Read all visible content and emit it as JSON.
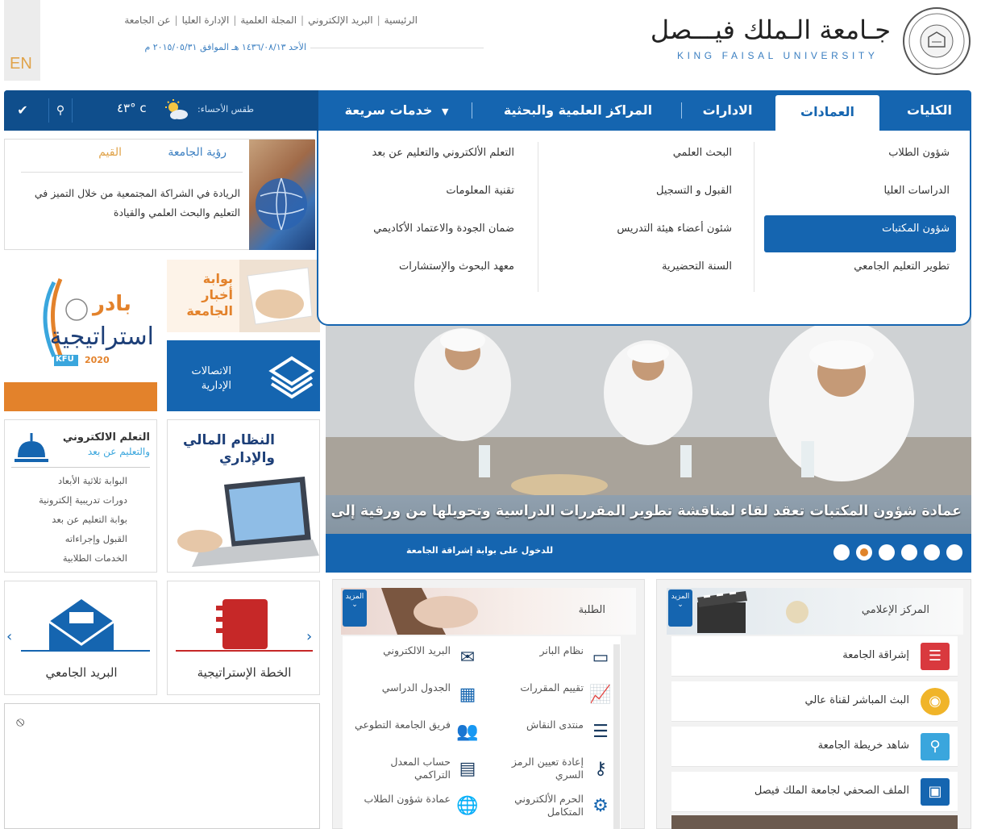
{
  "header": {
    "en_label": "EN",
    "top_links": [
      "الرئيسية",
      "البريد الإلكتروني",
      "المجلة العلمية",
      "الإدارة العليا",
      "عن الجامعة"
    ],
    "date_line": "الأحد ١٤٣٦/٠٨/١٣ هـ الموافق ٢٠١٥/٠٥/٣١ م",
    "logo_ar": "جـامعة الـملك فيـــصل",
    "logo_en": "KING FAISAL UNIVERSITY"
  },
  "nav": {
    "items": [
      "الكليات",
      "العمادات",
      "الادارات",
      "المراكز العلمية والبحثية",
      "خدمات سريعة"
    ],
    "active": "العمادات",
    "weather_label": "طقس الأحساء:",
    "weather_temp": "٤٣° c",
    "weather_icon": "sun-cloud-icon",
    "search_icon": "search-icon",
    "check_icon": "check-icon"
  },
  "dropdown": {
    "col1": [
      "شؤون الطلاب",
      "الدراسات العليا",
      "شؤون المكتبات",
      "تطوير التعليم الجامعي"
    ],
    "col2": [
      "البحث العلمي",
      "القبول و التسجيل",
      "شئون أعضاء هيئة التدريس",
      "السنة التحضيرية"
    ],
    "col3": [
      "التعلم الألكتروني والتعليم عن بعد",
      "تقنية المعلومات",
      "ضمان الجودة والاعتماد الأكاديمي",
      "معهد البحوث والإستشارات"
    ],
    "highlighted": "شؤون المكتبات"
  },
  "vision": {
    "tab_vision": "رؤية الجامعة",
    "tab_values": "القيم",
    "text": "الريادة في الشراكة المجتمعية من خلال التميز في التعليم والبحث العلمي والقيادة"
  },
  "tiles": {
    "strategy_top": "بادر",
    "strategy_main": "استراتيجية",
    "strategy_kfu": "KFU",
    "strategy_year": "2020",
    "news": "بوابة أخبار الجامعة",
    "comm": "الاتصالات الإدارية",
    "elearn_title": "التعلم الالكتروني",
    "elearn_sub": "والتعليم عن بعد",
    "elearn_links": [
      "البوابة ثلاثية الأبعاد",
      "دورات تدريبية إلكترونية",
      "بوابة التعليم عن بعد",
      "القبول وإجراءاته",
      "الخدمات الطلابية"
    ],
    "fin": "النظام المالي والإداري",
    "mail": "البريد الجامعي",
    "plan": "الخطة الإستراتيجية"
  },
  "hero": {
    "caption": "عمادة شؤون المكتبات تعقد لقاء لمناقشة تطوير المقررات الدراسية وتحويلها من ورقية إلى",
    "link": "للدخول على بوابة إشراقة الجامعة",
    "dots": 6,
    "active_dot": 5
  },
  "students": {
    "title": "الطلبة",
    "more": "المزيد",
    "items": [
      {
        "label": "نظام البانر",
        "icon": "monitor-icon"
      },
      {
        "label": "البريد الالكتروني",
        "icon": "mail-icon"
      },
      {
        "label": "تقييم المقررات",
        "icon": "chart-icon"
      },
      {
        "label": "الجدول الدراسي",
        "icon": "calendar-icon"
      },
      {
        "label": "منتدى النقاش",
        "icon": "forum-icon"
      },
      {
        "label": "فريق الجامعة التطوعي",
        "icon": "team-icon"
      },
      {
        "label": "إعادة تعيين الرمز السري",
        "icon": "key-icon"
      },
      {
        "label": "حساب المعدل التراكمي",
        "icon": "calculator-icon"
      },
      {
        "label": "الحرم الألكتروني المتكامل",
        "icon": "network-icon"
      },
      {
        "label": "عمادة شؤون الطلاب",
        "icon": "globe-icon"
      }
    ]
  },
  "media": {
    "title": "المركز الإعلامي",
    "more": "المزيد",
    "items": [
      {
        "label": "إشراقة الجامعة",
        "icon": "newspaper-icon",
        "color": "#d9393e"
      },
      {
        "label": "البث المباشر لقناة عالي",
        "icon": "broadcast-icon",
        "color": "#f0b429"
      },
      {
        "label": "شاهد خريطة الجامعة",
        "icon": "map-pin-icon",
        "color": "#3aa6dd"
      },
      {
        "label": "الملف الصحفي لجامعة الملك فيصل",
        "icon": "book-icon",
        "color": "#1565b0"
      }
    ]
  },
  "colors": {
    "primary": "#1565b0",
    "accent": "#e3822b",
    "gold": "#e0a34a"
  }
}
